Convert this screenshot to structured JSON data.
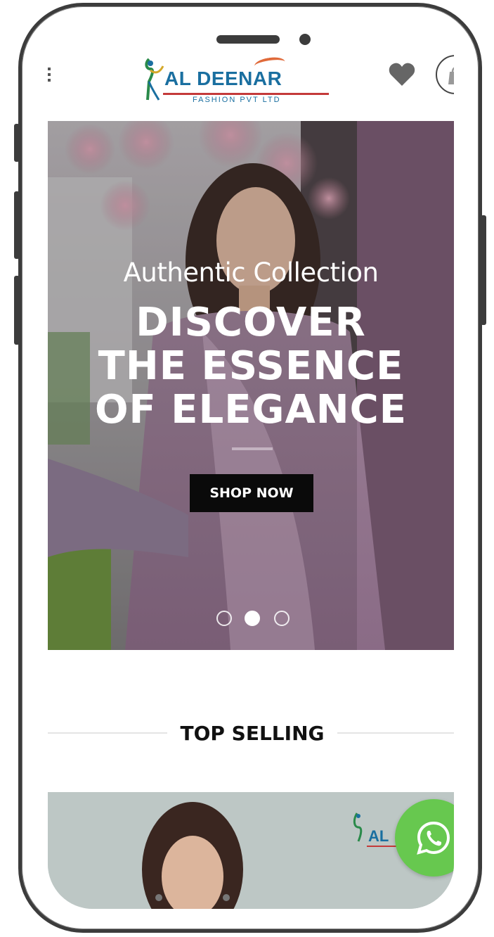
{
  "header": {
    "brand_name": "AL DEENAR",
    "brand_tagline": "FASHION PVT LTD"
  },
  "hero": {
    "kicker": "Authentic Collection",
    "headline_lines": [
      "DISCOVER",
      "THE ESSENCE",
      "OF ELEGANCE"
    ],
    "cta_label": "SHOP NOW",
    "slide_count": 3,
    "active_slide": 2
  },
  "sections": {
    "top_selling_title": "TOP SELLING"
  },
  "colors": {
    "hero_panel": "#6a4f64",
    "whatsapp": "#67c84f",
    "cta_bg": "#0a0a0a",
    "brand_blue": "#1a6fa0"
  },
  "icons": {
    "menu": "menu-dots-icon",
    "wishlist": "heart-icon",
    "cart": "shopping-bag-icon",
    "chat": "whatsapp-icon"
  }
}
